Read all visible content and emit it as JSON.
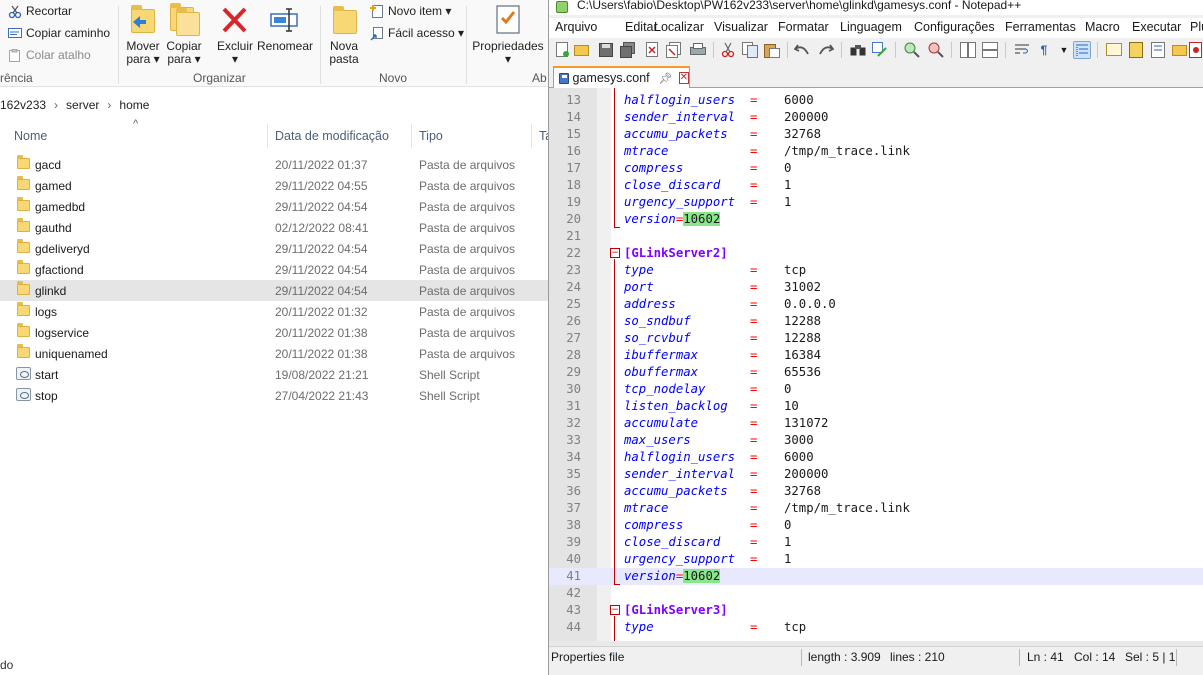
{
  "explorer": {
    "ribbon": {
      "clipboard": {
        "cut": "Recortar",
        "copy_path": "Copiar caminho",
        "paste_shortcut": "Colar atalho",
        "group_label": "rência"
      },
      "organize": {
        "move_to": "Mover",
        "move_to_sub": "para ▾",
        "copy_to": "Copiar",
        "copy_to_sub": "para ▾",
        "delete": "Excluir",
        "delete_sub": "▾",
        "rename": "Renomear",
        "group_label": "Organizar"
      },
      "new": {
        "new_folder": "Nova",
        "new_folder_sub": "pasta",
        "new_item": "Novo item ▾",
        "easy_access": "Fácil acesso ▾",
        "group_label": "Novo"
      },
      "open": {
        "properties": "Propriedades",
        "properties_sub": "▾",
        "group_label": "Ab"
      }
    },
    "breadcrumb": [
      "162v233",
      "server",
      "home"
    ],
    "columns": {
      "name": "Nome",
      "date": "Data de modificação",
      "type": "Tipo",
      "size": "Ta"
    },
    "files": [
      {
        "name": "gacd",
        "date": "20/11/2022 01:37",
        "type": "Pasta de arquivos",
        "kind": "folder"
      },
      {
        "name": "gamed",
        "date": "29/11/2022 04:55",
        "type": "Pasta de arquivos",
        "kind": "folder"
      },
      {
        "name": "gamedbd",
        "date": "29/11/2022 04:54",
        "type": "Pasta de arquivos",
        "kind": "folder"
      },
      {
        "name": "gauthd",
        "date": "02/12/2022 08:41",
        "type": "Pasta de arquivos",
        "kind": "folder"
      },
      {
        "name": "gdeliveryd",
        "date": "29/11/2022 04:54",
        "type": "Pasta de arquivos",
        "kind": "folder"
      },
      {
        "name": "gfactiond",
        "date": "29/11/2022 04:54",
        "type": "Pasta de arquivos",
        "kind": "folder"
      },
      {
        "name": "glinkd",
        "date": "29/11/2022 04:54",
        "type": "Pasta de arquivos",
        "kind": "folder",
        "selected": true
      },
      {
        "name": "logs",
        "date": "20/11/2022 01:32",
        "type": "Pasta de arquivos",
        "kind": "folder"
      },
      {
        "name": "logservice",
        "date": "20/11/2022 01:38",
        "type": "Pasta de arquivos",
        "kind": "folder"
      },
      {
        "name": "uniquenamed",
        "date": "20/11/2022 01:38",
        "type": "Pasta de arquivos",
        "kind": "folder"
      },
      {
        "name": "start",
        "date": "19/08/2022 21:21",
        "type": "Shell Script",
        "kind": "script"
      },
      {
        "name": "stop",
        "date": "27/04/2022 21:43",
        "type": "Shell Script",
        "kind": "script"
      }
    ],
    "status_text": "do"
  },
  "npp": {
    "title": "C:\\Users\\fabio\\Desktop\\PW162v233\\server\\home\\glinkd\\gamesys.conf - Notepad++",
    "menu": [
      "Arquivo",
      "Editar",
      "Localizar",
      "Visualizar",
      "Formatar",
      "Linguagem",
      "Configurações",
      "Ferramentas",
      "Macro",
      "Executar",
      "Plu"
    ],
    "tab": {
      "label": "gamesys.conf"
    },
    "lines": [
      {
        "n": "13",
        "key": "halflogin_users",
        "value": "6000"
      },
      {
        "n": "14",
        "key": "sender_interval",
        "value": "200000"
      },
      {
        "n": "15",
        "key": "accumu_packets",
        "value": "32768"
      },
      {
        "n": "16",
        "key": "mtrace",
        "value": "/tmp/m_trace.link"
      },
      {
        "n": "17",
        "key": "compress",
        "value": "0"
      },
      {
        "n": "18",
        "key": "close_discard",
        "value": "1"
      },
      {
        "n": "19",
        "key": "urgency_support",
        "value": "1"
      },
      {
        "n": "20",
        "version": "10602"
      },
      {
        "n": "21"
      },
      {
        "n": "22",
        "section": "[GLinkServer2]"
      },
      {
        "n": "23",
        "key": "type",
        "value": "tcp"
      },
      {
        "n": "24",
        "key": "port",
        "value": "31002"
      },
      {
        "n": "25",
        "key": "address",
        "value": "0.0.0.0"
      },
      {
        "n": "26",
        "key": "so_sndbuf",
        "value": "12288"
      },
      {
        "n": "27",
        "key": "so_rcvbuf",
        "value": "12288"
      },
      {
        "n": "28",
        "key": "ibuffermax",
        "value": "16384"
      },
      {
        "n": "29",
        "key": "obuffermax",
        "value": "65536"
      },
      {
        "n": "30",
        "key": "tcp_nodelay",
        "value": "0"
      },
      {
        "n": "31",
        "key": "listen_backlog",
        "value": "10"
      },
      {
        "n": "32",
        "key": "accumulate",
        "value": "131072"
      },
      {
        "n": "33",
        "key": "max_users",
        "value": "3000"
      },
      {
        "n": "34",
        "key": "halflogin_users",
        "value": "6000"
      },
      {
        "n": "35",
        "key": "sender_interval",
        "value": "200000"
      },
      {
        "n": "36",
        "key": "accumu_packets",
        "value": "32768"
      },
      {
        "n": "37",
        "key": "mtrace",
        "value": "/tmp/m_trace.link"
      },
      {
        "n": "38",
        "key": "compress",
        "value": "0"
      },
      {
        "n": "39",
        "key": "close_discard",
        "value": "1"
      },
      {
        "n": "40",
        "key": "urgency_support",
        "value": "1"
      },
      {
        "n": "41",
        "version": "10602",
        "current": true
      },
      {
        "n": "42"
      },
      {
        "n": "43",
        "section": "[GLinkServer3]"
      },
      {
        "n": "44",
        "key": "type",
        "value": "tcp"
      }
    ],
    "version_key": "version",
    "equals": "=",
    "status": {
      "file_type": "Properties file",
      "length": "length : 3.909",
      "lines": "lines : 210",
      "ln": "Ln : 41",
      "col": "Col : 14",
      "sel": "Sel : 5 | 1"
    }
  }
}
